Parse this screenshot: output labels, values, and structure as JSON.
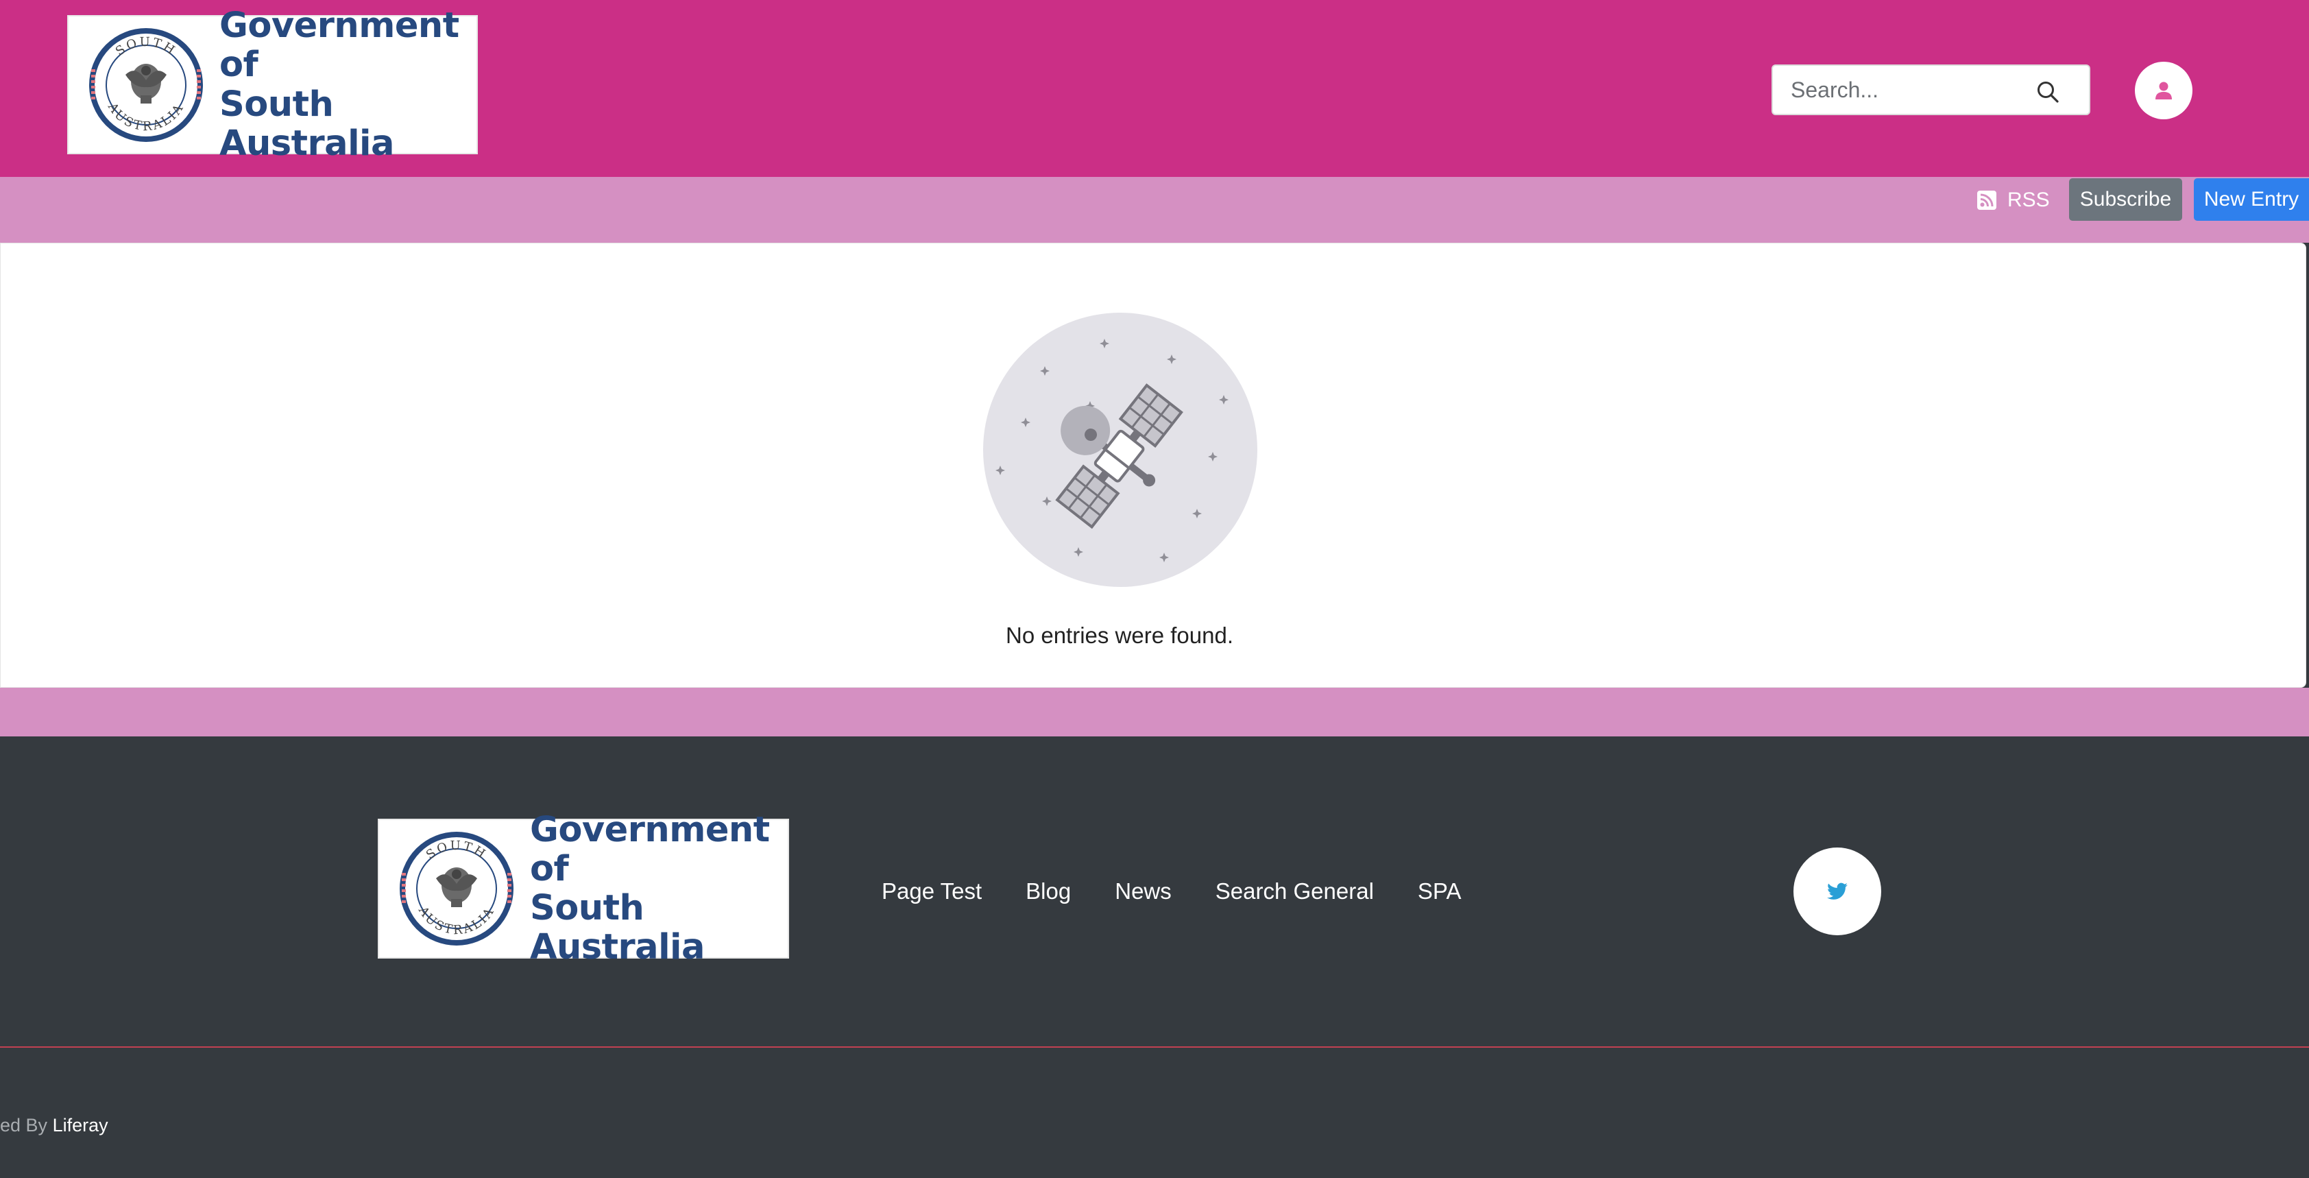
{
  "header": {
    "logo_text_line1": "Government of",
    "logo_text_line2": "South Australia",
    "seal_text_top": "SOUTH",
    "seal_text_bottom": "AUSTRALIA",
    "search_placeholder": "Search...",
    "search_icon": "search-icon",
    "user_icon": "user-icon"
  },
  "toolbar": {
    "rss_label": "RSS",
    "rss_icon": "rss-icon",
    "subscribe_label": "Subscribe",
    "new_entry_label": "New Entry"
  },
  "main": {
    "empty_icon": "satellite-illustration",
    "empty_message": "No entries were found."
  },
  "footer": {
    "logo_text_line1": "Government of",
    "logo_text_line2": "South Australia",
    "nav": [
      {
        "label": "Page Test"
      },
      {
        "label": "Blog"
      },
      {
        "label": "News"
      },
      {
        "label": "Search General"
      },
      {
        "label": "SPA"
      }
    ],
    "social_icon": "twitter-icon",
    "powered_prefix": "ed By",
    "powered_link": "Liferay"
  },
  "colors": {
    "header_bg": "#cb2f86",
    "toolbar_bg": "#d590c2",
    "footer_bg": "#353a3f",
    "subscribe_bg": "#6c757d",
    "new_entry_bg": "#2f80ed",
    "brand_text": "#27497f",
    "twitter": "#2a9fd6",
    "divider": "#c14152"
  }
}
